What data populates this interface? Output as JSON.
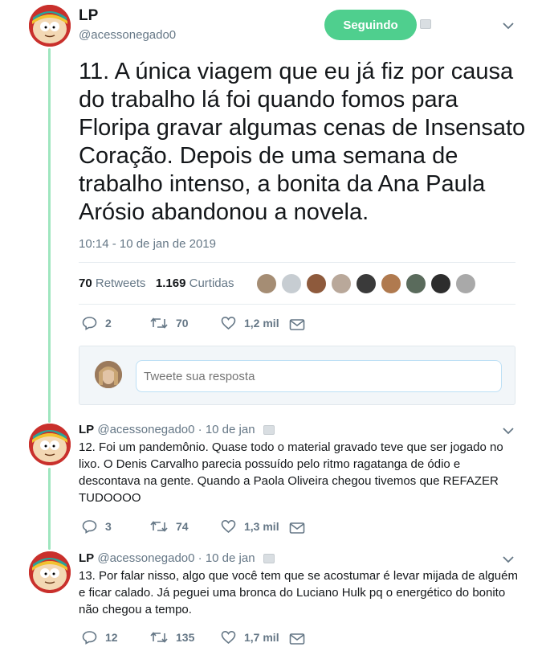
{
  "main_tweet": {
    "name": "LP",
    "handle": "@acessonegado0",
    "follow_label": "Seguindo",
    "text": "11. A única viagem que eu já fiz por causa do trabalho lá foi quando fomos para Floripa gravar algumas cenas de Insensato Coração. Depois de uma semana de trabalho intenso, a bonita da Ana Paula Arósio abandonou a novela.",
    "timestamp": "10:14 - 10 de jan de 2019",
    "retweets_count": "70",
    "retweets_label": "Retweets",
    "likes_count": "1.169",
    "likes_label": "Curtidas",
    "liker_colors": [
      "#a58d74",
      "#c7cdd2",
      "#8e5a3c",
      "#b9a89a",
      "#3a3a3a",
      "#b07a4f",
      "#5a6b5c",
      "#2d2d2d",
      "#a9a9a9"
    ],
    "actions": {
      "replies": "2",
      "retweets": "70",
      "likes": "1,2 mil"
    }
  },
  "reply_box": {
    "placeholder": "Tweete sua resposta"
  },
  "thread": [
    {
      "name": "LP",
      "handle": "@acessonegado0",
      "date": "· 10 de jan",
      "text": "12. Foi um pandemônio. Quase todo o material gravado teve que ser jogado no lixo. O Denis Carvalho parecia possuído pelo ritmo ragatanga de ódio e descontava na gente. Quando a Paola Oliveira chegou tivemos que REFAZER TUDOOOO",
      "actions": {
        "replies": "3",
        "retweets": "74",
        "likes": "1,3 mil"
      }
    },
    {
      "name": "LP",
      "handle": "@acessonegado0",
      "date": "· 10 de jan",
      "text": "13. Por falar nisso, algo que você tem que se acostumar é levar mijada de alguém e ficar calado. Já peguei uma bronca do Luciano Hulk pq o energético do bonito não chegou a tempo.",
      "actions": {
        "replies": "12",
        "retweets": "135",
        "likes": "1,7 mil"
      }
    }
  ],
  "colors": {
    "accent_green": "#4fcf8e",
    "thread_line": "#9fe6bf",
    "muted": "#657786"
  },
  "icons": [
    "reply-icon",
    "retweet-icon",
    "like-icon",
    "message-icon",
    "chevron-down-icon"
  ]
}
